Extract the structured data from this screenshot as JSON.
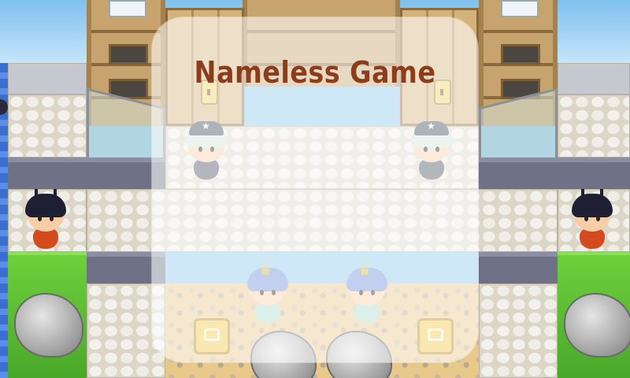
{
  "game": {
    "title": "Nameless Game"
  },
  "characters": [
    {
      "kind": "player",
      "side": "left"
    },
    {
      "kind": "player",
      "side": "right"
    },
    {
      "kind": "guard",
      "side": "left"
    },
    {
      "kind": "guard",
      "side": "right"
    },
    {
      "kind": "queen",
      "side": "left"
    },
    {
      "kind": "queen",
      "side": "right"
    }
  ],
  "icons": [
    "dark-character-icon",
    "guard-character-icon",
    "queen-character-icon",
    "boulder-icon",
    "key-tile-icon",
    "padlock-icon"
  ],
  "colors": {
    "title": "#8b3d1c",
    "grass": "#5bbf33",
    "stone": "#dcd6c8",
    "wood": "#c7a36d",
    "water": "#3a6fd0"
  }
}
